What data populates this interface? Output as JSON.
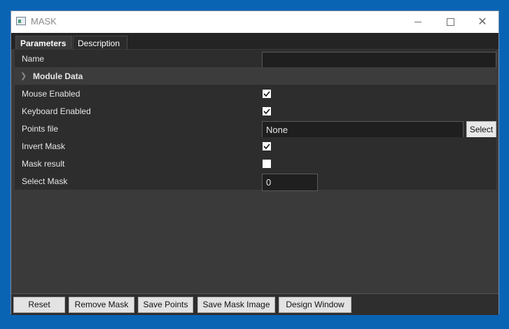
{
  "window": {
    "title": "MASK",
    "icon": "app-window-icon"
  },
  "tabs": [
    {
      "label": "Parameters",
      "active": true
    },
    {
      "label": "Description",
      "active": false
    }
  ],
  "params": {
    "name_label": "Name",
    "name_value": "",
    "group_label": "Module Data",
    "mouse_enabled_label": "Mouse Enabled",
    "mouse_enabled": true,
    "keyboard_enabled_label": "Keyboard Enabled",
    "keyboard_enabled": true,
    "points_file_label": "Points file",
    "points_file_value": "None",
    "select_label": "Select",
    "invert_mask_label": "Invert Mask",
    "invert_mask": true,
    "mask_result_label": "Mask result",
    "mask_result": false,
    "select_mask_label": "Select Mask",
    "select_mask_value": "0"
  },
  "buttons": {
    "reset": "Reset",
    "remove_mask": "Remove Mask",
    "save_points": "Save Points",
    "save_mask_image": "Save Mask Image",
    "design_window": "Design Window"
  },
  "colors": {
    "desktop": "#0a64b4",
    "panel_bg": "#3a3a3a",
    "row_bg": "#2d2d2d",
    "input_bg": "#1f1f1f"
  }
}
